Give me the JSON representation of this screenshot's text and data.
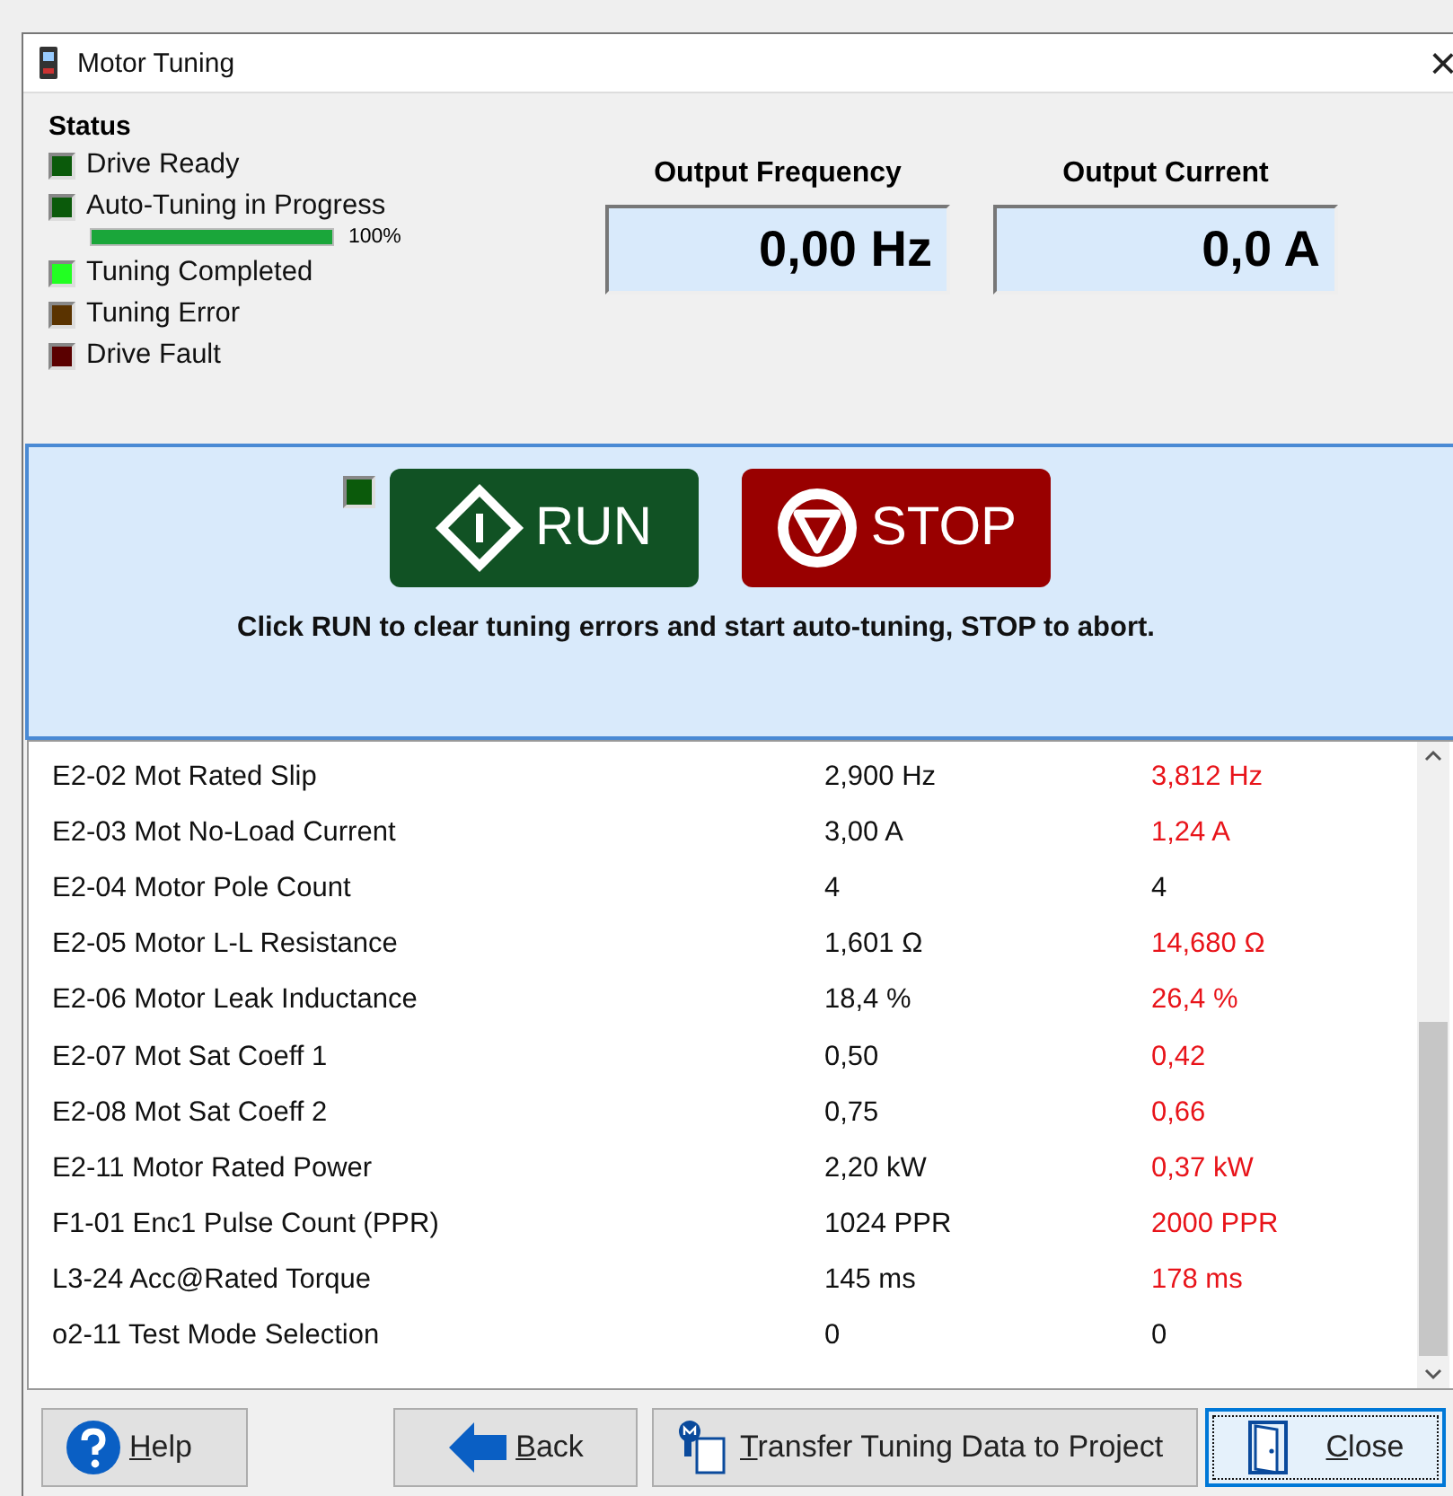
{
  "window": {
    "title": "Motor Tuning",
    "close": "×"
  },
  "status": {
    "title": "Status",
    "indicators": [
      {
        "label": "Drive Ready",
        "color": "#0b5a0b"
      },
      {
        "label": "Auto-Tuning in Progress",
        "color": "#0b5a0b",
        "progress": {
          "level": 1,
          "text": "100%"
        }
      },
      {
        "label": "Tuning Completed",
        "color": "#22ff22"
      },
      {
        "label": "Tuning Error",
        "color": "#5a3300"
      },
      {
        "label": "Drive Fault",
        "color": "#5a0000"
      }
    ]
  },
  "readouts": [
    {
      "label": "Output Frequency",
      "value": "0,00 Hz"
    },
    {
      "label": "Output Current",
      "value": "0,0 A"
    }
  ],
  "control": {
    "indicator_lit": false,
    "run": "RUN",
    "stop": "STOP",
    "hint": "Click RUN to clear tuning errors and start auto-tuning, STOP to abort."
  },
  "table": {
    "rows": [
      {
        "parameter": "E2-02 Mot Rated Slip",
        "current": "2,900 Hz",
        "tuned": "3,812 Hz",
        "changed": true
      },
      {
        "parameter": "E2-03 Mot No-Load Current",
        "current": "3,00 A",
        "tuned": "1,24 A",
        "changed": true
      },
      {
        "parameter": "E2-04 Motor Pole Count",
        "current": "4",
        "tuned": "4",
        "changed": false
      },
      {
        "parameter": "E2-05 Motor L-L Resistance",
        "current": "1,601 Ω",
        "tuned": "14,680 Ω",
        "changed": true
      },
      {
        "parameter": "E2-06 Motor Leak Inductance",
        "current": "18,4 %",
        "tuned": "26,4 %",
        "changed": true
      },
      {
        "parameter": "E2-07 Mot Sat Coeff 1",
        "current": "0,50",
        "tuned": "0,42",
        "changed": true
      },
      {
        "parameter": "E2-08 Mot Sat Coeff 2",
        "current": "0,75",
        "tuned": "0,66",
        "changed": true
      },
      {
        "parameter": "E2-11 Motor Rated Power",
        "current": "2,20 kW",
        "tuned": "0,37 kW",
        "changed": true
      },
      {
        "parameter": "F1-01 Enc1 Pulse Count (PPR)",
        "current": "1024 PPR",
        "tuned": "2000 PPR",
        "changed": true
      },
      {
        "parameter": "L3-24 Acc@Rated Torque",
        "current": "145 ms",
        "tuned": "178 ms",
        "changed": true
      },
      {
        "parameter": "o2-11 Test Mode Selection",
        "current": "0",
        "tuned": "0",
        "changed": false
      }
    ]
  },
  "buttons": [
    {
      "kind": "help",
      "accel": "H",
      "rest": "elp",
      "focused": false
    },
    {
      "kind": "back",
      "accel": "B",
      "rest": "ack",
      "focused": false
    },
    {
      "kind": "transfer",
      "accel": "T",
      "rest": "ransfer Tuning Data to Project",
      "focused": false
    },
    {
      "kind": "close",
      "accel": "C",
      "rest": "lose",
      "focused": true
    }
  ]
}
